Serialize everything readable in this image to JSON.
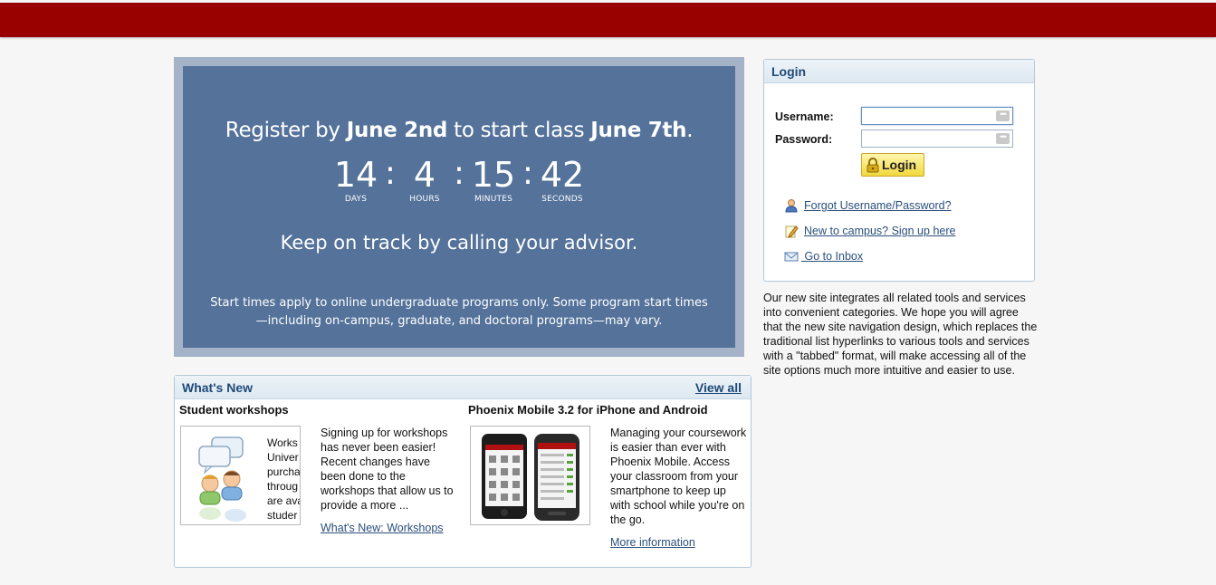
{
  "banner": {
    "headline_pre": "Register by ",
    "headline_date1": "June 2nd",
    "headline_mid": " to start class ",
    "headline_date2": "June 7th",
    "headline_post": ".",
    "countdown": [
      {
        "value": "14",
        "label": "DAYS"
      },
      {
        "value": "4",
        "label": "HOURS"
      },
      {
        "value": "15",
        "label": "MINUTES"
      },
      {
        "value": "42",
        "label": "SECONDS"
      }
    ],
    "separator": ":",
    "subline": "Keep on track by calling your advisor.",
    "note": "Start times apply to online undergraduate programs only. Some program start times—including on-campus, graduate, and doctoral programs—may vary."
  },
  "whats_new": {
    "title": "What's New",
    "view_all": "View all",
    "items": [
      {
        "title": "Student workshops",
        "thumb_text": "Works\nUniver\npurcha\nthroug\nare ava\nstuder",
        "text": "Signing up for workshops has never been easier! Recent changes have been done to the workshops that allow us to provide a more ...",
        "link": "What's New: Workshops"
      },
      {
        "title": "Phoenix Mobile 3.2 for iPhone and Android",
        "text": "Managing your coursework is easier than ever with Phoenix Mobile. Access your classroom from your smartphone to keep up with school while you're on the go.",
        "link": "More information"
      }
    ]
  },
  "login": {
    "title": "Login",
    "username_label": "Username:",
    "password_label": "Password:",
    "username_value": "",
    "password_value": "",
    "button_label": "Login",
    "links": [
      {
        "icon": "user-icon",
        "label": "Forgot Username/Password?"
      },
      {
        "icon": "pencil-note-icon",
        "label": "New to campus? Sign up here"
      },
      {
        "icon": "envelope-icon",
        "label": " Go to Inbox"
      }
    ]
  },
  "intro": {
    "text": "Our new site integrates all related tools and services into convenient categories. We hope you will agree that the new site navigation design, which replaces the traditional list hyperlinks to various tools and services with a \"tabbed\" format, will make accessing all of the site options much more intuitive and easier to use."
  },
  "colors": {
    "top_bar": "#990000",
    "banner_bg": "#54729a",
    "banner_frame": "#a5b3c8",
    "header_text": "#1f4a77",
    "link": "#2a4f7c",
    "login_button": "#f1d83c"
  }
}
